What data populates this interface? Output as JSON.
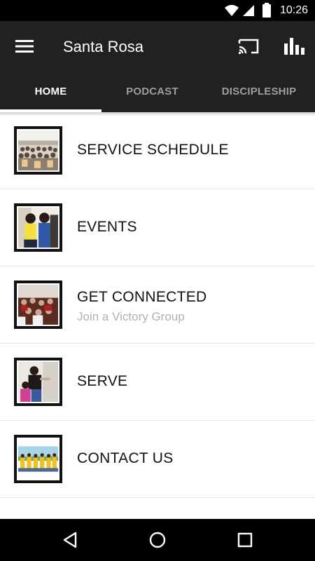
{
  "status_bar": {
    "time": "10:26",
    "icons": [
      "wifi-icon",
      "signal-icon",
      "battery-icon"
    ]
  },
  "app_bar": {
    "title": "Santa Rosa",
    "icons": [
      "menu-icon",
      "cast-icon",
      "bar-chart-icon"
    ],
    "background": "#212121"
  },
  "tabs": [
    {
      "label": "HOME",
      "active": true
    },
    {
      "label": "PODCAST",
      "active": false
    },
    {
      "label": "DISCIPLESHIP",
      "active": false
    }
  ],
  "list": {
    "items": [
      {
        "title": "SERVICE SCHEDULE",
        "subtitle": "",
        "thumbnail": "congregation-photo"
      },
      {
        "title": "EVENTS",
        "subtitle": "",
        "thumbnail": "women-photo"
      },
      {
        "title": "GET CONNECTED",
        "subtitle": "Join a Victory Group",
        "thumbnail": "group-photo"
      },
      {
        "title": "SERVE",
        "subtitle": "",
        "thumbnail": "volunteers-photo"
      },
      {
        "title": "CONTACT US",
        "subtitle": "",
        "thumbnail": "team-photo"
      }
    ]
  },
  "nav_bar": {
    "icons": [
      "back-icon",
      "home-icon",
      "recents-icon"
    ]
  }
}
